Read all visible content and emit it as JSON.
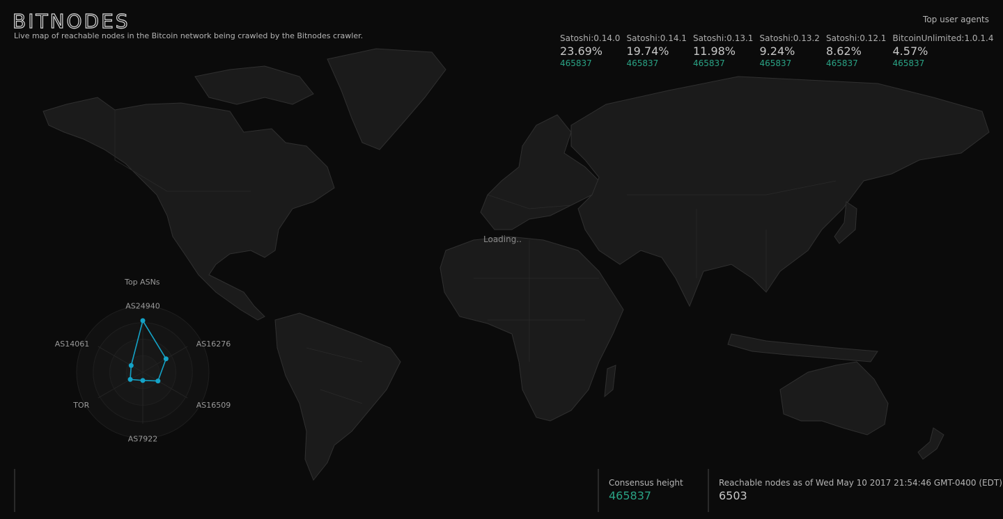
{
  "header": {
    "logo": "BITNODES",
    "subtitle": "Live map of reachable nodes in the Bitcoin network being crawled by the Bitnodes crawler."
  },
  "user_agents": {
    "title": "Top user agents",
    "items": [
      {
        "name": "Satoshi:0.14.0",
        "pct": "23.69%",
        "height": "465837"
      },
      {
        "name": "Satoshi:0.14.1",
        "pct": "19.74%",
        "height": "465837"
      },
      {
        "name": "Satoshi:0.13.1",
        "pct": "11.98%",
        "height": "465837"
      },
      {
        "name": "Satoshi:0.13.2",
        "pct": "9.24%",
        "height": "465837"
      },
      {
        "name": "Satoshi:0.12.1",
        "pct": "8.62%",
        "height": "465837"
      },
      {
        "name": "BitcoinUnlimited:1.0.1.4",
        "pct": "4.57%",
        "height": "465837"
      }
    ]
  },
  "map": {
    "loading": "Loading.."
  },
  "asns": {
    "title": "Top ASNs",
    "labels": [
      "AS24940",
      "AS16276",
      "AS16509",
      "AS7922",
      "TOR",
      "AS14061"
    ],
    "values": [
      1.0,
      0.52,
      0.34,
      0.16,
      0.28,
      0.26
    ],
    "color": "#14a3c7"
  },
  "footer": {
    "consensus_label": "Consensus height",
    "consensus_value": "465837",
    "reachable_label": "Reachable nodes as of Wed May 10 2017 21:54:46 GMT-0400 (EDT)",
    "reachable_value": "6503"
  },
  "colors": {
    "accent": "#2aa385",
    "land": "#1b1b1b",
    "border": "#303030",
    "background": "#0b0b0b"
  }
}
